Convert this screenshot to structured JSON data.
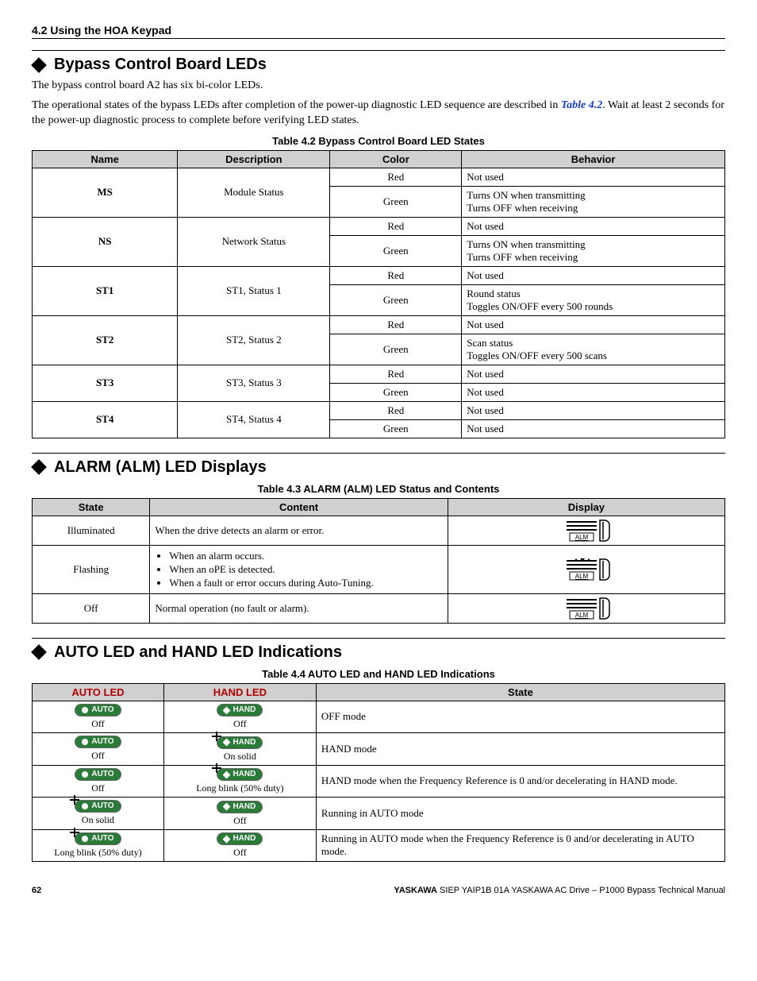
{
  "header": "4.2 Using the HOA Keypad",
  "sec1": {
    "title": "Bypass Control Board LEDs",
    "p1": "The bypass control board A2 has six bi-color LEDs.",
    "p2a": "The operational states of the bypass LEDs after completion of the power-up diagnostic LED sequence are described in ",
    "p2link": "Table 4.2",
    "p2b": ". Wait at least 2 seconds for the power-up diagnostic process to complete before verifying LED states.",
    "caption": "Table 4.2  Bypass Control Board LED States",
    "cols": [
      "Name",
      "Description",
      "Color",
      "Behavior"
    ],
    "rows": [
      {
        "name": "MS",
        "desc": "Module Status",
        "sub": [
          {
            "color": "Red",
            "beh": "Not used"
          },
          {
            "color": "Green",
            "beh": "Turns ON when transmitting\nTurns OFF when receiving"
          }
        ]
      },
      {
        "name": "NS",
        "desc": "Network Status",
        "sub": [
          {
            "color": "Red",
            "beh": "Not used"
          },
          {
            "color": "Green",
            "beh": "Turns ON when transmitting\nTurns OFF when receiving"
          }
        ]
      },
      {
        "name": "ST1",
        "desc": "ST1, Status 1",
        "sub": [
          {
            "color": "Red",
            "beh": "Not used"
          },
          {
            "color": "Green",
            "beh": "Round status\nToggles ON/OFF every 500 rounds"
          }
        ]
      },
      {
        "name": "ST2",
        "desc": "ST2, Status 2",
        "sub": [
          {
            "color": "Red",
            "beh": "Not used"
          },
          {
            "color": "Green",
            "beh": "Scan status\nToggles ON/OFF every 500 scans"
          }
        ]
      },
      {
        "name": "ST3",
        "desc": "ST3, Status 3",
        "sub": [
          {
            "color": "Red",
            "beh": "Not used"
          },
          {
            "color": "Green",
            "beh": "Not used"
          }
        ]
      },
      {
        "name": "ST4",
        "desc": "ST4, Status 4",
        "sub": [
          {
            "color": "Red",
            "beh": "Not used"
          },
          {
            "color": "Green",
            "beh": "Not used"
          }
        ]
      }
    ]
  },
  "sec2": {
    "title": "ALARM (ALM) LED Displays",
    "caption": "Table 4.3  ALARM (ALM) LED Status and Contents",
    "cols": [
      "State",
      "Content",
      "Display"
    ],
    "rows": [
      {
        "state": "Illuminated",
        "content": "When the drive detects an alarm or error.",
        "icon": "alm-on"
      },
      {
        "state": "Flashing",
        "bullets": [
          "When an alarm occurs.",
          "When an oPE is detected.",
          "When a fault or error occurs during Auto-Tuning."
        ],
        "icon": "alm-flash"
      },
      {
        "state": "Off",
        "content": "Normal operation (no fault or alarm).",
        "icon": "alm-off"
      }
    ]
  },
  "sec3": {
    "title": "AUTO LED and HAND LED Indications",
    "caption": "Table 4.4  AUTO LED and HAND LED Indications",
    "cols": [
      "AUTO LED",
      "HAND LED",
      "State"
    ],
    "rows": [
      {
        "auto": {
          "label": "AUTO",
          "sub": "Off",
          "spark": false
        },
        "hand": {
          "label": "HAND",
          "sub": "Off",
          "spark": false
        },
        "state": "OFF mode"
      },
      {
        "auto": {
          "label": "AUTO",
          "sub": "Off",
          "spark": false
        },
        "hand": {
          "label": "HAND",
          "sub": "On solid",
          "spark": true
        },
        "state": "HAND mode"
      },
      {
        "auto": {
          "label": "AUTO",
          "sub": "Off",
          "spark": false
        },
        "hand": {
          "label": "HAND",
          "sub": "Long blink (50% duty)",
          "spark": true
        },
        "state": "HAND mode when the Frequency Reference is 0 and/or decelerating in HAND mode."
      },
      {
        "auto": {
          "label": "AUTO",
          "sub": "On solid",
          "spark": true
        },
        "hand": {
          "label": "HAND",
          "sub": "Off",
          "spark": false
        },
        "state": "Running in AUTO mode"
      },
      {
        "auto": {
          "label": "AUTO",
          "sub": "Long blink (50% duty)",
          "spark": true
        },
        "hand": {
          "label": "HAND",
          "sub": "Off",
          "spark": false
        },
        "state": "Running in AUTO mode when the Frequency Reference is 0 and/or decelerating in AUTO mode."
      }
    ]
  },
  "footer": {
    "page": "62",
    "brand": "YASKAWA",
    "rest": " SIEP YAIP1B 01A YASKAWA AC Drive – P1000 Bypass Technical Manual"
  }
}
